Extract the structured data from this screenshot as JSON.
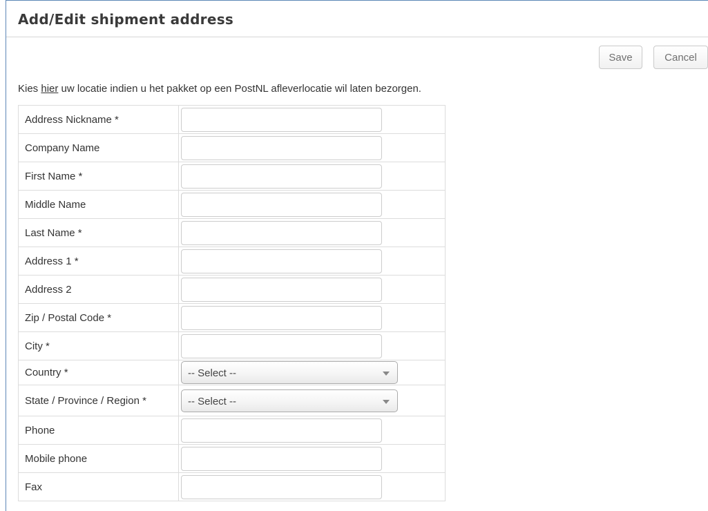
{
  "page": {
    "title": "Add/Edit shipment address"
  },
  "toolbar": {
    "save_label": "Save",
    "cancel_label": "Cancel"
  },
  "hint": {
    "prefix": "Kies ",
    "link": "hier",
    "suffix": " uw locatie indien u het pakket op een PostNL afleverlocatie wil laten bezorgen."
  },
  "form": {
    "fields": [
      {
        "label": "Address Nickname *",
        "value": ""
      },
      {
        "label": "Company Name",
        "value": ""
      },
      {
        "label": "First Name *",
        "value": ""
      },
      {
        "label": "Middle Name",
        "value": ""
      },
      {
        "label": "Last Name *",
        "value": ""
      },
      {
        "label": "Address 1 *",
        "value": ""
      },
      {
        "label": "Address 2",
        "value": ""
      },
      {
        "label": "Zip / Postal Code *",
        "value": ""
      },
      {
        "label": "City *",
        "value": ""
      }
    ],
    "country": {
      "label": "Country *",
      "selected": "-- Select --"
    },
    "state": {
      "label": "State / Province / Region *",
      "selected": "-- Select --"
    },
    "extra_fields": [
      {
        "label": "Phone",
        "value": ""
      },
      {
        "label": "Mobile phone",
        "value": ""
      },
      {
        "label": "Fax",
        "value": ""
      }
    ]
  },
  "icons": {
    "select_arrow": "chevron-down-icon"
  },
  "colors": {
    "frame_border": "#5b86b6",
    "text": "#333333",
    "field_border": "#cccccc"
  }
}
